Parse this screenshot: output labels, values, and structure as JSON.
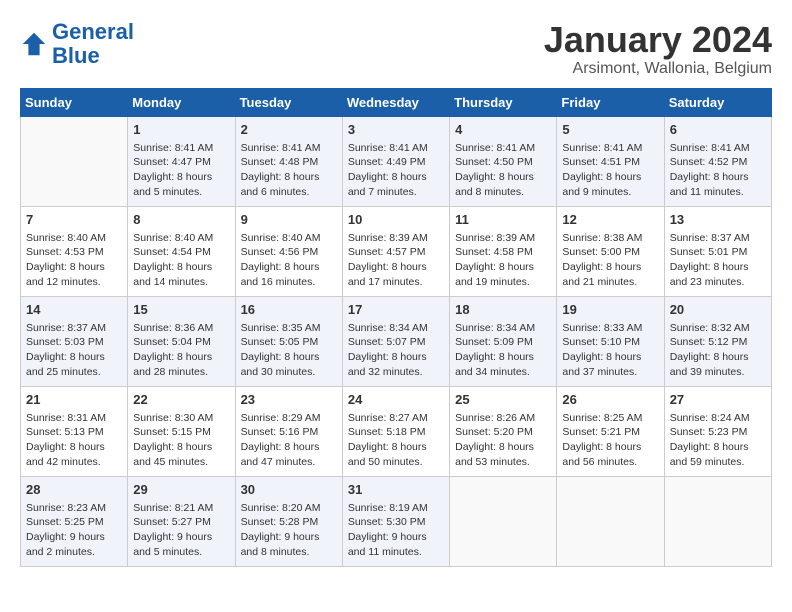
{
  "header": {
    "logo_line1": "General",
    "logo_line2": "Blue",
    "title": "January 2024",
    "subtitle": "Arsimont, Wallonia, Belgium"
  },
  "days_of_week": [
    "Sunday",
    "Monday",
    "Tuesday",
    "Wednesday",
    "Thursday",
    "Friday",
    "Saturday"
  ],
  "weeks": [
    [
      {
        "day": "",
        "info": ""
      },
      {
        "day": "1",
        "info": "Sunrise: 8:41 AM\nSunset: 4:47 PM\nDaylight: 8 hours\nand 5 minutes."
      },
      {
        "day": "2",
        "info": "Sunrise: 8:41 AM\nSunset: 4:48 PM\nDaylight: 8 hours\nand 6 minutes."
      },
      {
        "day": "3",
        "info": "Sunrise: 8:41 AM\nSunset: 4:49 PM\nDaylight: 8 hours\nand 7 minutes."
      },
      {
        "day": "4",
        "info": "Sunrise: 8:41 AM\nSunset: 4:50 PM\nDaylight: 8 hours\nand 8 minutes."
      },
      {
        "day": "5",
        "info": "Sunrise: 8:41 AM\nSunset: 4:51 PM\nDaylight: 8 hours\nand 9 minutes."
      },
      {
        "day": "6",
        "info": "Sunrise: 8:41 AM\nSunset: 4:52 PM\nDaylight: 8 hours\nand 11 minutes."
      }
    ],
    [
      {
        "day": "7",
        "info": "Sunrise: 8:40 AM\nSunset: 4:53 PM\nDaylight: 8 hours\nand 12 minutes."
      },
      {
        "day": "8",
        "info": "Sunrise: 8:40 AM\nSunset: 4:54 PM\nDaylight: 8 hours\nand 14 minutes."
      },
      {
        "day": "9",
        "info": "Sunrise: 8:40 AM\nSunset: 4:56 PM\nDaylight: 8 hours\nand 16 minutes."
      },
      {
        "day": "10",
        "info": "Sunrise: 8:39 AM\nSunset: 4:57 PM\nDaylight: 8 hours\nand 17 minutes."
      },
      {
        "day": "11",
        "info": "Sunrise: 8:39 AM\nSunset: 4:58 PM\nDaylight: 8 hours\nand 19 minutes."
      },
      {
        "day": "12",
        "info": "Sunrise: 8:38 AM\nSunset: 5:00 PM\nDaylight: 8 hours\nand 21 minutes."
      },
      {
        "day": "13",
        "info": "Sunrise: 8:37 AM\nSunset: 5:01 PM\nDaylight: 8 hours\nand 23 minutes."
      }
    ],
    [
      {
        "day": "14",
        "info": "Sunrise: 8:37 AM\nSunset: 5:03 PM\nDaylight: 8 hours\nand 25 minutes."
      },
      {
        "day": "15",
        "info": "Sunrise: 8:36 AM\nSunset: 5:04 PM\nDaylight: 8 hours\nand 28 minutes."
      },
      {
        "day": "16",
        "info": "Sunrise: 8:35 AM\nSunset: 5:05 PM\nDaylight: 8 hours\nand 30 minutes."
      },
      {
        "day": "17",
        "info": "Sunrise: 8:34 AM\nSunset: 5:07 PM\nDaylight: 8 hours\nand 32 minutes."
      },
      {
        "day": "18",
        "info": "Sunrise: 8:34 AM\nSunset: 5:09 PM\nDaylight: 8 hours\nand 34 minutes."
      },
      {
        "day": "19",
        "info": "Sunrise: 8:33 AM\nSunset: 5:10 PM\nDaylight: 8 hours\nand 37 minutes."
      },
      {
        "day": "20",
        "info": "Sunrise: 8:32 AM\nSunset: 5:12 PM\nDaylight: 8 hours\nand 39 minutes."
      }
    ],
    [
      {
        "day": "21",
        "info": "Sunrise: 8:31 AM\nSunset: 5:13 PM\nDaylight: 8 hours\nand 42 minutes."
      },
      {
        "day": "22",
        "info": "Sunrise: 8:30 AM\nSunset: 5:15 PM\nDaylight: 8 hours\nand 45 minutes."
      },
      {
        "day": "23",
        "info": "Sunrise: 8:29 AM\nSunset: 5:16 PM\nDaylight: 8 hours\nand 47 minutes."
      },
      {
        "day": "24",
        "info": "Sunrise: 8:27 AM\nSunset: 5:18 PM\nDaylight: 8 hours\nand 50 minutes."
      },
      {
        "day": "25",
        "info": "Sunrise: 8:26 AM\nSunset: 5:20 PM\nDaylight: 8 hours\nand 53 minutes."
      },
      {
        "day": "26",
        "info": "Sunrise: 8:25 AM\nSunset: 5:21 PM\nDaylight: 8 hours\nand 56 minutes."
      },
      {
        "day": "27",
        "info": "Sunrise: 8:24 AM\nSunset: 5:23 PM\nDaylight: 8 hours\nand 59 minutes."
      }
    ],
    [
      {
        "day": "28",
        "info": "Sunrise: 8:23 AM\nSunset: 5:25 PM\nDaylight: 9 hours\nand 2 minutes."
      },
      {
        "day": "29",
        "info": "Sunrise: 8:21 AM\nSunset: 5:27 PM\nDaylight: 9 hours\nand 5 minutes."
      },
      {
        "day": "30",
        "info": "Sunrise: 8:20 AM\nSunset: 5:28 PM\nDaylight: 9 hours\nand 8 minutes."
      },
      {
        "day": "31",
        "info": "Sunrise: 8:19 AM\nSunset: 5:30 PM\nDaylight: 9 hours\nand 11 minutes."
      },
      {
        "day": "",
        "info": ""
      },
      {
        "day": "",
        "info": ""
      },
      {
        "day": "",
        "info": ""
      }
    ]
  ]
}
